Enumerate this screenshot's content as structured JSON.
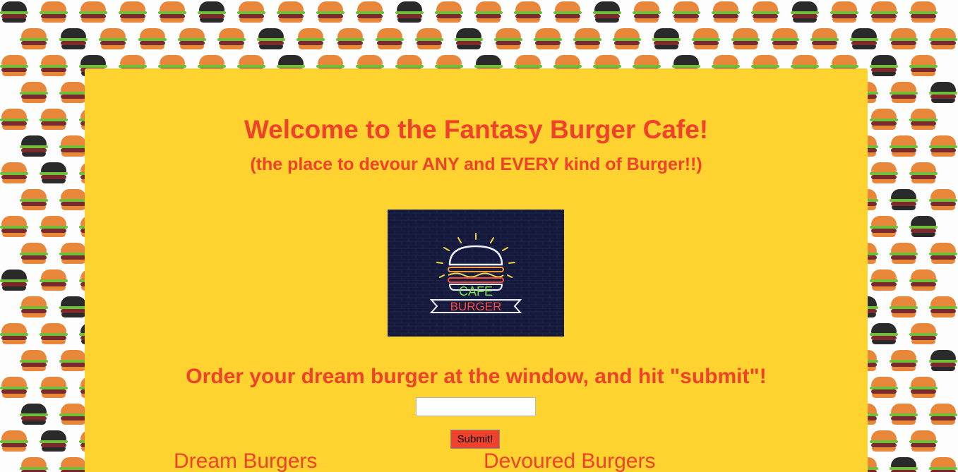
{
  "header": {
    "title": "Welcome to the Fantasy Burger Cafe!",
    "tagline": "(the place to devour ANY and EVERY kind of Burger!!)"
  },
  "logo": {
    "top_word": "CAFE",
    "bottom_word": "BURGER"
  },
  "order": {
    "prompt": "Order your dream burger at the window, and hit \"submit\"!",
    "input_value": "",
    "input_placeholder": "",
    "submit_label": "Submit!"
  },
  "columns": {
    "dream_title": "Dream Burgers",
    "devoured_title": "Devoured Burgers"
  },
  "colors": {
    "panel": "#fed22f",
    "accent_text": "#f0422a",
    "button": "#f0422a",
    "logo_background": "#15193a"
  }
}
